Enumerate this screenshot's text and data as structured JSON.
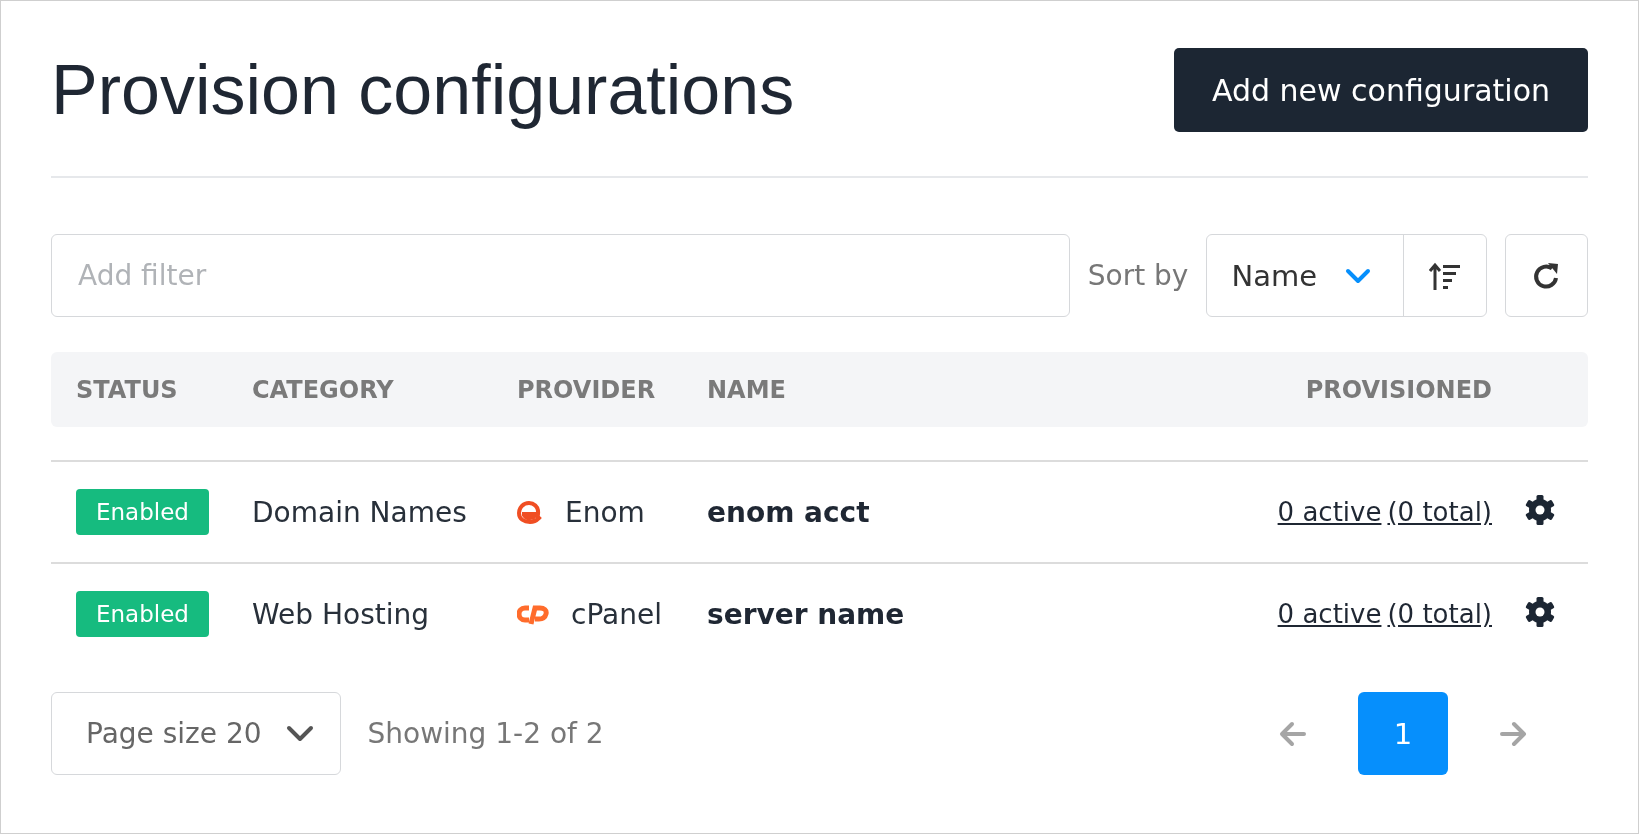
{
  "title": "Provision configurations",
  "add_button": "Add new configuration",
  "filter": {
    "placeholder": "Add filter"
  },
  "sort": {
    "label": "Sort by",
    "value": "Name",
    "ascending": true
  },
  "table": {
    "columns": [
      "STATUS",
      "CATEGORY",
      "PROVIDER",
      "NAME",
      "PROVISIONED"
    ],
    "rows": [
      {
        "status": "Enabled",
        "enabled": true,
        "category": "Domain Names",
        "provider": "Enom",
        "kind": "swoosh",
        "name": "enom acct",
        "active": "0 active",
        "total": "(0 total)"
      },
      {
        "status": "Enabled",
        "enabled": true,
        "category": "Web Hosting",
        "provider": "cPanel",
        "kind": "double-arc",
        "name": "server name",
        "active": "0 active",
        "total": "(0 total)"
      }
    ]
  },
  "footer": {
    "page_size": "Page size 20",
    "showing": "Showing 1-2 of 2",
    "prev_disabled": true,
    "next_disabled": true,
    "pages": [
      {
        "label": "1",
        "selected": true
      }
    ]
  }
}
